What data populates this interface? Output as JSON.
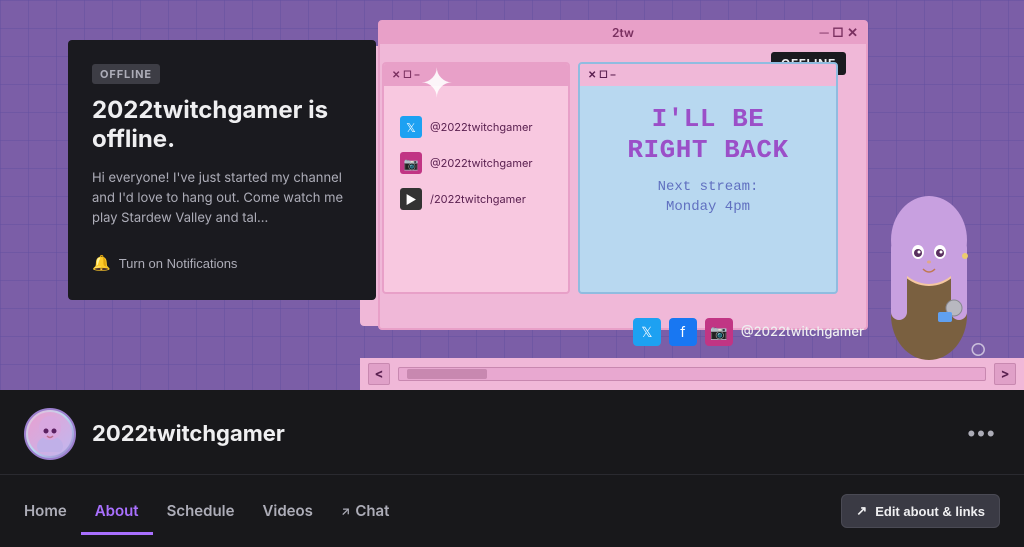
{
  "hero": {
    "offline_badge": "OFFLINE",
    "offline_title": "2022twitchgamer is offline.",
    "offline_desc": "Hi everyone! I've just started my channel and I'd love to hang out. Come watch me play Stardew Valley and tal...",
    "notif_label": "Turn on Notifications",
    "win_title": "2tw",
    "second_offline": "OFFLINE",
    "social_twitter": "@2022twitchgamer",
    "social_insta": "@2022twitchgamer",
    "social_yt": "/2022twitchgamer",
    "irb_line1": "I'LL BE",
    "irb_line2": "RIGHT BACK",
    "irb_next": "Next stream:\nMonday 4pm",
    "bottom_handle": "@2022twitchgamer"
  },
  "channel": {
    "name": "2022twitchgamer",
    "more_icon": "•••"
  },
  "nav": {
    "tabs": [
      {
        "id": "home",
        "label": "Home",
        "active": false
      },
      {
        "id": "about",
        "label": "About",
        "active": true
      },
      {
        "id": "schedule",
        "label": "Schedule",
        "active": false
      },
      {
        "id": "videos",
        "label": "Videos",
        "active": false
      },
      {
        "id": "chat",
        "label": "Chat",
        "active": false,
        "external": true
      }
    ],
    "edit_label": "Edit about & links",
    "edit_icon": "↗"
  }
}
